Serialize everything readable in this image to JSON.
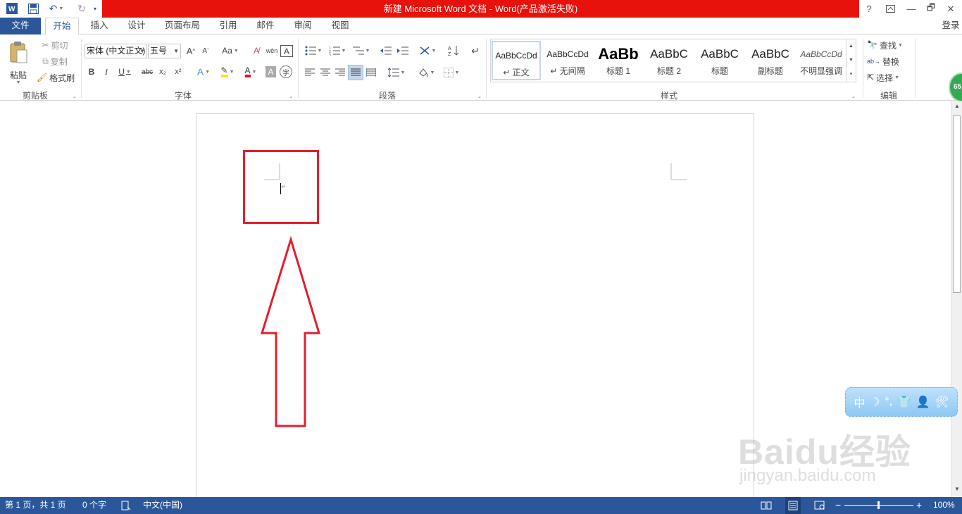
{
  "window": {
    "title": "新建 Microsoft Word 文档 -  Word(产品激活失败)",
    "login": "登录",
    "help": "?",
    "minimize": "—",
    "restore": "🗗",
    "close": "✕"
  },
  "tabs": [
    "文件",
    "开始",
    "插入",
    "设计",
    "页面布局",
    "引用",
    "邮件",
    "审阅",
    "视图"
  ],
  "active_tab": "开始",
  "clipboard": {
    "paste": "粘贴",
    "cut": "剪切",
    "copy": "复制",
    "format_painter": "格式刷",
    "label": "剪贴板"
  },
  "font": {
    "name": "宋体 (中文正文)",
    "size": "五号",
    "label": "字体",
    "bold": "B",
    "italic": "I",
    "underline": "U",
    "strikethrough": "abc",
    "subscript": "x₂",
    "superscript": "x²",
    "grow": "A",
    "shrink": "A",
    "change_case": "Aa",
    "phonetic": "wén",
    "char_border": "A",
    "char_shading": "A",
    "enclose": "字",
    "effects": "A",
    "font_color": "A"
  },
  "paragraph": {
    "label": "段落"
  },
  "styles": {
    "label": "样式",
    "items": [
      {
        "sample": "AaBbCcDd",
        "name": "↵ 正文"
      },
      {
        "sample": "AaBbCcDd",
        "name": "↵ 无间隔"
      },
      {
        "sample": "AaBb",
        "name": "标题 1"
      },
      {
        "sample": "AaBbC",
        "name": "标题 2"
      },
      {
        "sample": "AaBbC",
        "name": "标题"
      },
      {
        "sample": "AaBbC",
        "name": "副标题"
      },
      {
        "sample": "AaBbCcDd",
        "name": "不明显强调"
      }
    ]
  },
  "editing": {
    "find": "查找",
    "replace": "替换",
    "select": "选择",
    "label": "编辑"
  },
  "statusbar": {
    "page": "第 1 页，共 1 页",
    "words": "0 个字",
    "language": "中文(中国)",
    "zoom": "100%",
    "zoom_minus": "−",
    "zoom_plus": "+"
  },
  "ime": [
    "中",
    "☽",
    "°,",
    "👕",
    "👤",
    "🛠"
  ],
  "badge": "65",
  "watermark": {
    "logo": "Baidu经验",
    "url": "jingyan.baidu.com"
  },
  "annotation_color": "#e41e2b",
  "accent": "#2b579a"
}
